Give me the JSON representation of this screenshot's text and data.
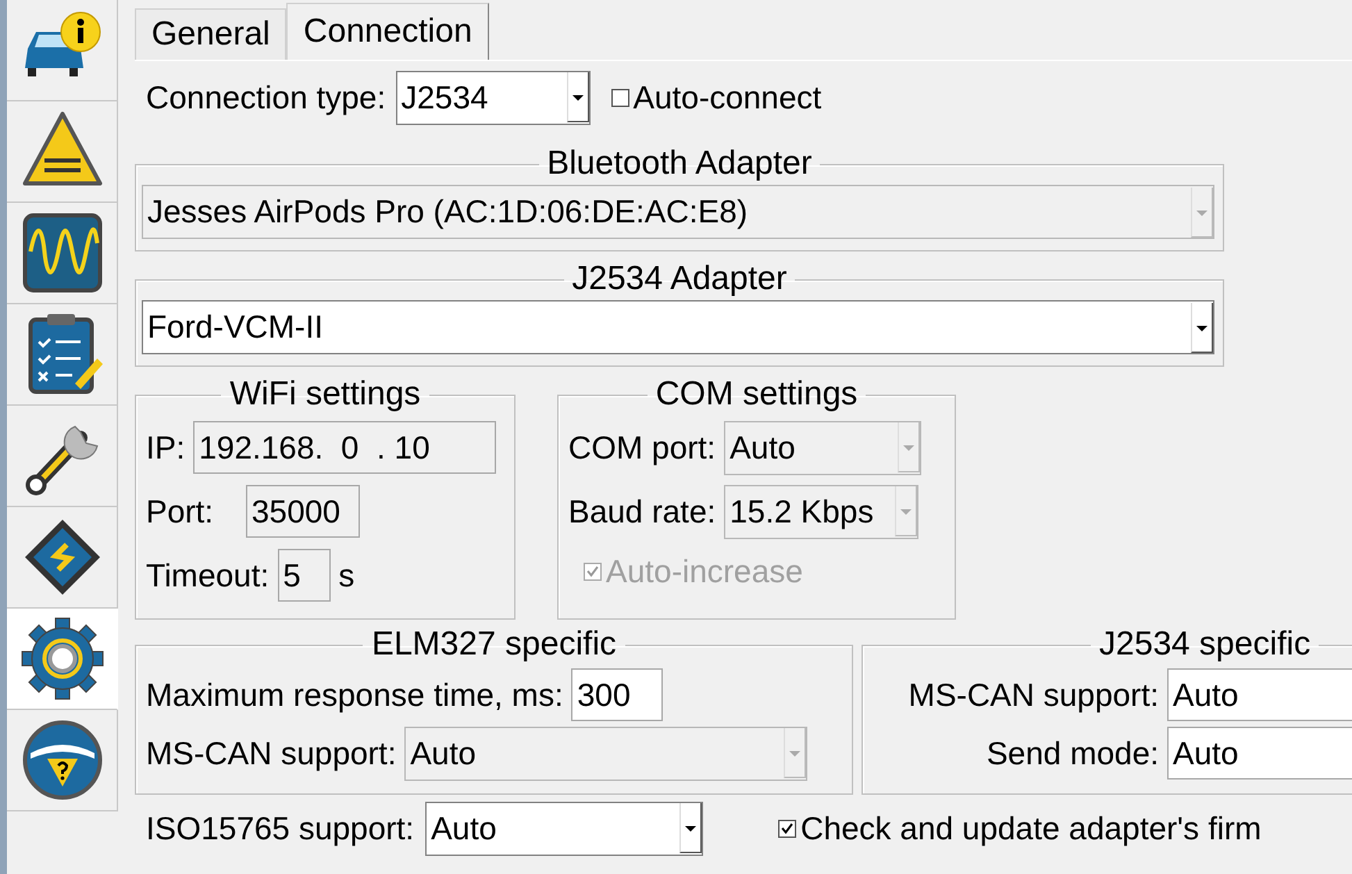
{
  "sidebar": {
    "items": [
      {
        "kind": "car-info",
        "selected": false
      },
      {
        "kind": "dtc",
        "selected": false
      },
      {
        "kind": "scope",
        "selected": false
      },
      {
        "kind": "checklist",
        "selected": false
      },
      {
        "kind": "wrench",
        "selected": false
      },
      {
        "kind": "chip",
        "selected": false
      },
      {
        "kind": "gear",
        "selected": true
      },
      {
        "kind": "help",
        "selected": false
      }
    ]
  },
  "tabs": [
    {
      "label": "General",
      "selected": false
    },
    {
      "label": "Connection",
      "selected": true
    }
  ],
  "connection_type": {
    "label": "Connection type:",
    "value": "J2534",
    "disabled": false
  },
  "auto_connect": {
    "label": "Auto-connect",
    "checked": false,
    "disabled": false
  },
  "bluetooth_adapter": {
    "title": "Bluetooth Adapter",
    "value": "Jesses AirPods Pro (AC:1D:06:DE:AC:E8)",
    "disabled": true
  },
  "j2534_adapter": {
    "title": "J2534 Adapter",
    "value": "Ford-VCM-II",
    "disabled": false
  },
  "wifi_settings": {
    "title": "WiFi settings",
    "ip": {
      "label": "IP:",
      "value": "192.168.  0  . 10"
    },
    "port": {
      "label": "Port:",
      "value": "35000"
    },
    "timeout": {
      "label": "Timeout:",
      "value": "5",
      "unit": "s"
    }
  },
  "com_settings": {
    "title": "COM settings",
    "com_port": {
      "label": "COM port:",
      "value": "Auto",
      "disabled": true
    },
    "baud_rate": {
      "label": "Baud rate:",
      "value": "15.2 Kbps",
      "disabled": true
    },
    "auto_increase": {
      "label": "Auto-increase",
      "checked": true,
      "disabled": true
    }
  },
  "elm327_specific": {
    "title": "ELM327 specific",
    "max_response": {
      "label": "Maximum response time, ms:",
      "value": "300"
    },
    "ms_can": {
      "label": "MS-CAN support:",
      "value": "Auto",
      "disabled": true
    }
  },
  "j2534_specific": {
    "title": "J2534 specific",
    "ms_can": {
      "label": "MS-CAN support:",
      "value": "Auto"
    },
    "send_mode": {
      "label": "Send mode:",
      "value": "Auto"
    }
  },
  "iso15765": {
    "label": "ISO15765 support:",
    "value": "Auto",
    "disabled": false
  },
  "firmware_check": {
    "label": "Check and update adapter's firm",
    "checked": true,
    "disabled": false
  }
}
